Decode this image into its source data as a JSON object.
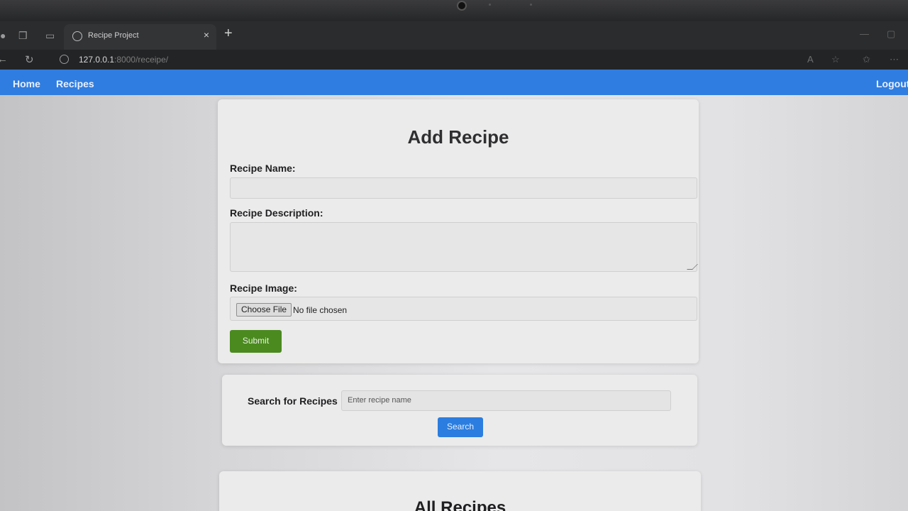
{
  "browser": {
    "tab_title": "Recipe Project",
    "tab_close": "×",
    "new_tab": "+",
    "url_host": "127.0.0.1",
    "url_rest": ":8000/receipe/"
  },
  "navbar": {
    "home": "Home",
    "recipes": "Recipes",
    "logout": "Logout"
  },
  "form": {
    "title": "Add Recipe",
    "name_label": "Recipe Name:",
    "name_value": "",
    "description_label": "Recipe Description:",
    "description_value": "",
    "image_label": "Recipe Image:",
    "file_button": "Choose File",
    "file_status": "No file chosen",
    "submit": "Submit"
  },
  "search": {
    "label": "Search for Recipes",
    "placeholder": "Enter recipe name",
    "button": "Search"
  },
  "list": {
    "title": "All Recipes"
  },
  "colors": {
    "navbar": "#2f7de0",
    "submit": "#4a8a1f",
    "search_button": "#2b7ddf"
  }
}
